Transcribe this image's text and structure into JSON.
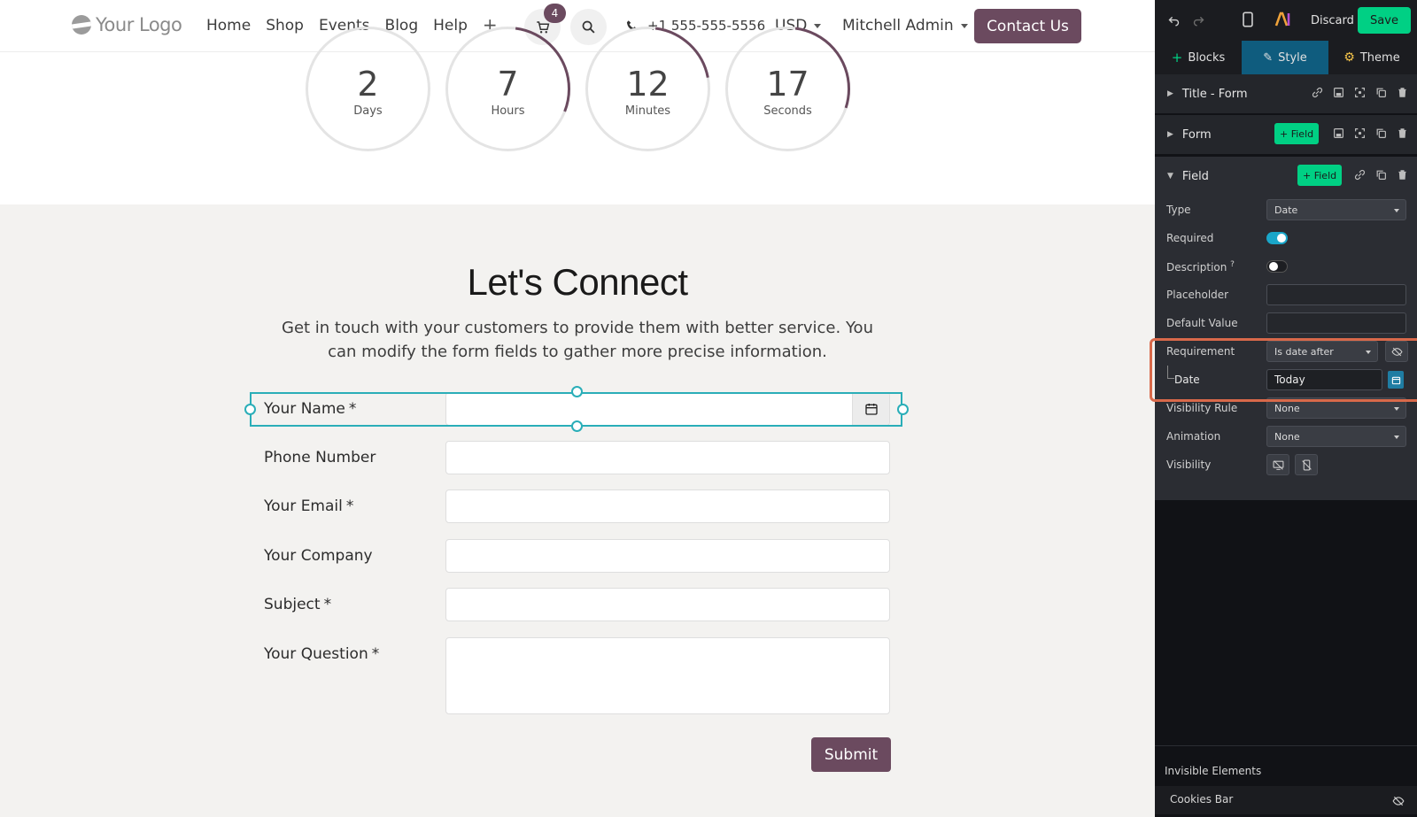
{
  "site": {
    "logo_text": "Your Logo",
    "menu": [
      "Home",
      "Shop",
      "Events",
      "Blog",
      "Help"
    ],
    "cart_count": "4",
    "phone": "+1 555-555-5556",
    "currency": "USD",
    "user": "Mitchell Admin",
    "contact_label": "Contact Us",
    "countdown": [
      {
        "value": "2",
        "unit": "Days",
        "progress": 0.0
      },
      {
        "value": "7",
        "unit": "Hours",
        "progress": 0.29
      },
      {
        "value": "12",
        "unit": "Minutes",
        "progress": 0.2
      },
      {
        "value": "17",
        "unit": "Seconds",
        "progress": 0.28
      }
    ],
    "form": {
      "heading": "Let's Connect",
      "subtext": "Get in touch with your customers to provide them with better service. You can modify the form fields to gather more precise information.",
      "fields": [
        {
          "label": "Your Name",
          "required": true
        },
        {
          "label": "Phone Number",
          "required": false
        },
        {
          "label": "Your Email",
          "required": true
        },
        {
          "label": "Your Company",
          "required": false
        },
        {
          "label": "Subject",
          "required": true
        },
        {
          "label": "Your Question",
          "required": true
        }
      ],
      "required_marker": "*",
      "submit_label": "Submit"
    }
  },
  "panel": {
    "discard_label": "Discard",
    "save_label": "Save",
    "tabs": [
      "Blocks",
      "Style",
      "Theme"
    ],
    "active_tab": "Style",
    "sections": {
      "title_form": "Title - Form",
      "form": "Form",
      "field": "Field",
      "add_field_label": "+ Field"
    },
    "options": {
      "type_label": "Type",
      "type_value": "Date",
      "required_label": "Required",
      "required_on": true,
      "description_label": "Description",
      "description_help": "?",
      "description_on": false,
      "placeholder_label": "Placeholder",
      "placeholder_value": "",
      "default_label": "Default Value",
      "default_value": "",
      "requirement_label": "Requirement",
      "requirement_value": "Is date after",
      "date_label": "Date",
      "date_value": "Today",
      "visibility_rule_label": "Visibility Rule",
      "visibility_rule_value": "None",
      "animation_label": "Animation",
      "animation_value": "None",
      "visibility_label": "Visibility"
    },
    "invisible_title": "Invisible Elements",
    "invisible_items": [
      "Cookies Bar"
    ]
  },
  "colors": {
    "brand": "#6b4a5f",
    "accent_teal": "#2aaeb8",
    "save_green": "#00d084",
    "highlight": "#d9694a"
  }
}
